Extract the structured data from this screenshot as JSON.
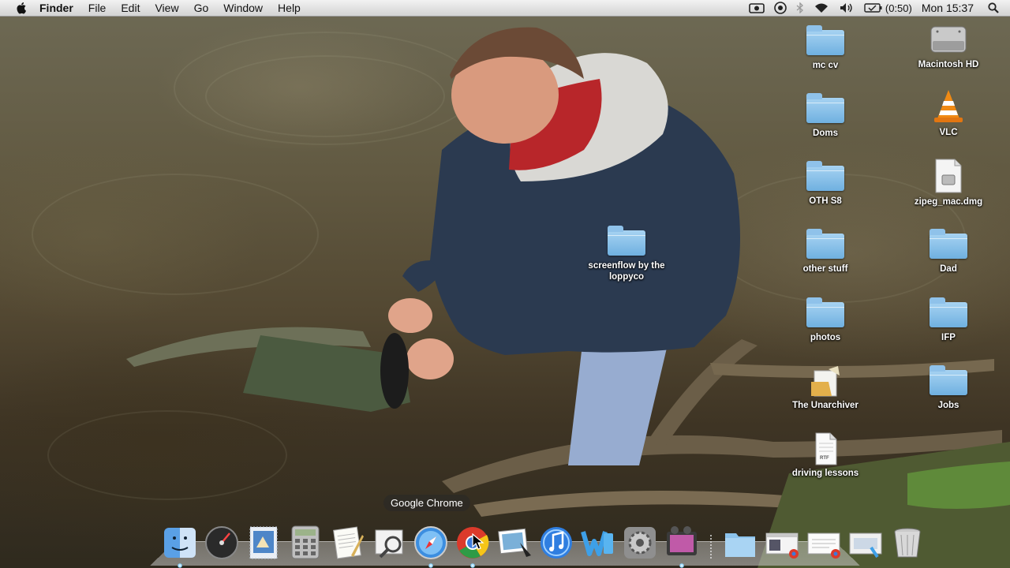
{
  "menubar": {
    "items": [
      {
        "label": "Finder",
        "bold": true
      },
      {
        "label": "File"
      },
      {
        "label": "Edit"
      },
      {
        "label": "View"
      },
      {
        "label": "Go"
      },
      {
        "label": "Window"
      },
      {
        "label": "Help"
      }
    ],
    "status": {
      "battery_time": "(0:50)",
      "clock": "Mon 15:37",
      "icons": [
        "screen-record-icon",
        "sync-icon",
        "bluetooth-icon",
        "wifi-icon",
        "volume-icon",
        "battery-icon",
        "spotlight-icon"
      ]
    }
  },
  "desktop": {
    "icons": [
      {
        "label": "mc cv",
        "type": "folder"
      },
      {
        "label": "Macintosh HD",
        "type": "drive"
      },
      {
        "label": "Doms",
        "type": "folder"
      },
      {
        "label": "VLC",
        "type": "app"
      },
      {
        "label": "OTH S8",
        "type": "folder"
      },
      {
        "label": "zipeg_mac.dmg",
        "type": "file"
      },
      {
        "label": "screenflow by the loppyco",
        "type": "folder"
      },
      {
        "label": "other stuff",
        "type": "folder"
      },
      {
        "label": "Dad",
        "type": "folder"
      },
      {
        "label": "photos",
        "type": "folder"
      },
      {
        "label": "IFP",
        "type": "folder"
      },
      {
        "label": "The Unarchiver",
        "type": "app"
      },
      {
        "label": "Jobs",
        "type": "folder"
      },
      {
        "label": "driving lessons",
        "type": "file",
        "badge": "RTF"
      }
    ]
  },
  "dock": {
    "tooltip": "Google Chrome",
    "items": [
      "Finder",
      "Dashboard",
      "Mail",
      "Calculator",
      "TextEdit",
      "Preview",
      "Safari",
      "Google Chrome",
      "iPhoto",
      "iTunes",
      "Word",
      "System Preferences",
      "Photo Booth",
      "Folder",
      "Window 1",
      "Window 2",
      "Window 3",
      "Trash"
    ]
  }
}
